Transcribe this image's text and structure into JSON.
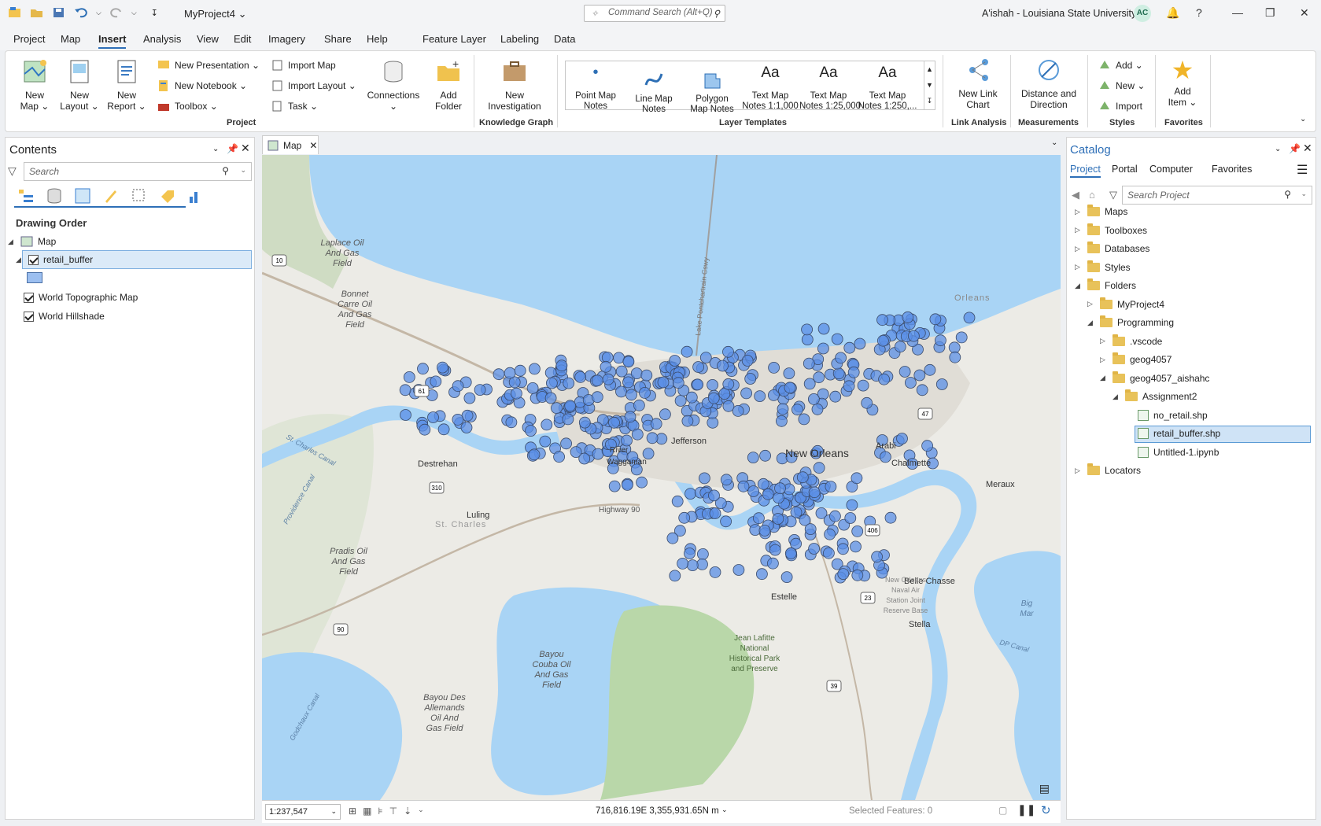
{
  "titlebar": {
    "project_name": "MyProject4 ⌄",
    "command_search_placeholder": "Command Search (Alt+Q)",
    "user": "A'ishah - Louisiana State University",
    "avatar_initials": "AC"
  },
  "menu": {
    "items": [
      "Project",
      "Map",
      "Insert",
      "Analysis",
      "View",
      "Edit",
      "Imagery",
      "Share",
      "Help"
    ],
    "active": "Insert",
    "contextual_tabs": [
      "Feature Layer",
      "Labeling",
      "Data"
    ]
  },
  "ribbon": {
    "new_map": "New\nMap ⌄",
    "new_layout": "New\nLayout ⌄",
    "new_report": "New\nReport ⌄",
    "new_presentation": "New Presentation  ⌄",
    "new_notebook": "New Notebook  ⌄",
    "toolbox": "Toolbox ⌄",
    "import_map": "Import Map",
    "import_layout": "Import Layout ⌄",
    "task": "Task ⌄",
    "connections": "Connections\n⌄",
    "add_folder": "Add\nFolder",
    "new_investigation": "New\nInvestigation",
    "gallery": [
      "Point Map\nNotes",
      "Line Map\nNotes",
      "Polygon\nMap Notes",
      "Text Map\nNotes 1:1,000",
      "Text Map\nNotes 1:25,000",
      "Text Map\nNotes 1:250,..."
    ],
    "new_link_chart": "New Link\nChart",
    "distance_direction": "Distance and\nDirection",
    "add": "Add ⌄",
    "new": "New ⌄",
    "import": "Import",
    "add_item": "Add\nItem ⌄",
    "groups": [
      "Project",
      "Knowledge Graph",
      "Layer Templates",
      "Link Analysis",
      "Measurements",
      "Styles",
      "Favorites"
    ]
  },
  "contents": {
    "title": "Contents",
    "search_placeholder": "Search",
    "drawing_order": "Drawing Order",
    "map_name": "Map",
    "layers": [
      "retail_buffer",
      "World Topographic Map",
      "World Hillshade"
    ]
  },
  "map": {
    "tab": "Map",
    "labels": {
      "orleans": "Orleans",
      "laplace": "Laplace Oil\nAnd Gas\nField",
      "bonnet_carre": "Bonnet\nCarre Oil\nAnd Gas\nField",
      "pradis": "Pradis Oil\nAnd Gas\nField",
      "bayou_couba": "Bayou\nCouba Oil\nAnd Gas\nField",
      "bayou_des_allemands": "Bayou Des\nAllemands\nOil And\nGas Field",
      "destrehan": "Destrehan",
      "luling": "Luling",
      "st_charles": "St. Charles",
      "jefferson": "Jefferson",
      "new_orleans": "New Orleans",
      "arabi": "Arabi",
      "chalmette": "Chalmette",
      "meraux": "Meraux",
      "belle_chasse": "Belle Chasse",
      "estelle": "Estelle",
      "stella": "Stella",
      "big_mar": "Big\nMar",
      "jean_lafitte": "Jean Lafitte\nNational\nHistorical Park\nand Preserve",
      "lake_pontchartrain_csw": "Lake Pontchartrain Cswy",
      "highway": "Highway 90",
      "st_charles_canal": "St. Charles Canal",
      "providence_canal": "Providence Canal",
      "godchaux_canal": "Godchaux Canal",
      "dp_canal": "DP Canal",
      "naval": "New Orleans\nNaval Air\nStation Joint\nReserve Base",
      "waggaman": "Waggaman",
      "river_ridge": "River",
      "shields": [
        "10",
        "61",
        "310",
        "90",
        "47",
        "406",
        "23",
        "39"
      ]
    },
    "scale": "1:237,547",
    "coordinates": "716,816.19E 3,355,931.65N m",
    "selected_features": "Selected Features: 0"
  },
  "catalog": {
    "title": "Catalog",
    "tabs": [
      "Project",
      "Portal",
      "Computer",
      "Favorites"
    ],
    "search_placeholder": "Search Project",
    "tree": [
      {
        "label": "Maps",
        "level": 0,
        "expanded": false
      },
      {
        "label": "Toolboxes",
        "level": 0,
        "expanded": false
      },
      {
        "label": "Databases",
        "level": 0,
        "expanded": false
      },
      {
        "label": "Styles",
        "level": 0,
        "expanded": false
      },
      {
        "label": "Folders",
        "level": 0,
        "expanded": true
      },
      {
        "label": "MyProject4",
        "level": 1,
        "expanded": false
      },
      {
        "label": "Programming",
        "level": 1,
        "expanded": true
      },
      {
        "label": ".vscode",
        "level": 2,
        "expanded": false
      },
      {
        "label": "geog4057",
        "level": 2,
        "expanded": false
      },
      {
        "label": "geog4057_aishahc",
        "level": 2,
        "expanded": true
      },
      {
        "label": "Assignment2",
        "level": 3,
        "expanded": true
      },
      {
        "label": "no_retail.shp",
        "level": 4,
        "expanded": null
      },
      {
        "label": "retail_buffer.shp",
        "level": 4,
        "expanded": null,
        "selected": true
      },
      {
        "label": "Untitled-1.ipynb",
        "level": 4,
        "expanded": null
      },
      {
        "label": "Locators",
        "level": 0,
        "expanded": false
      }
    ]
  }
}
